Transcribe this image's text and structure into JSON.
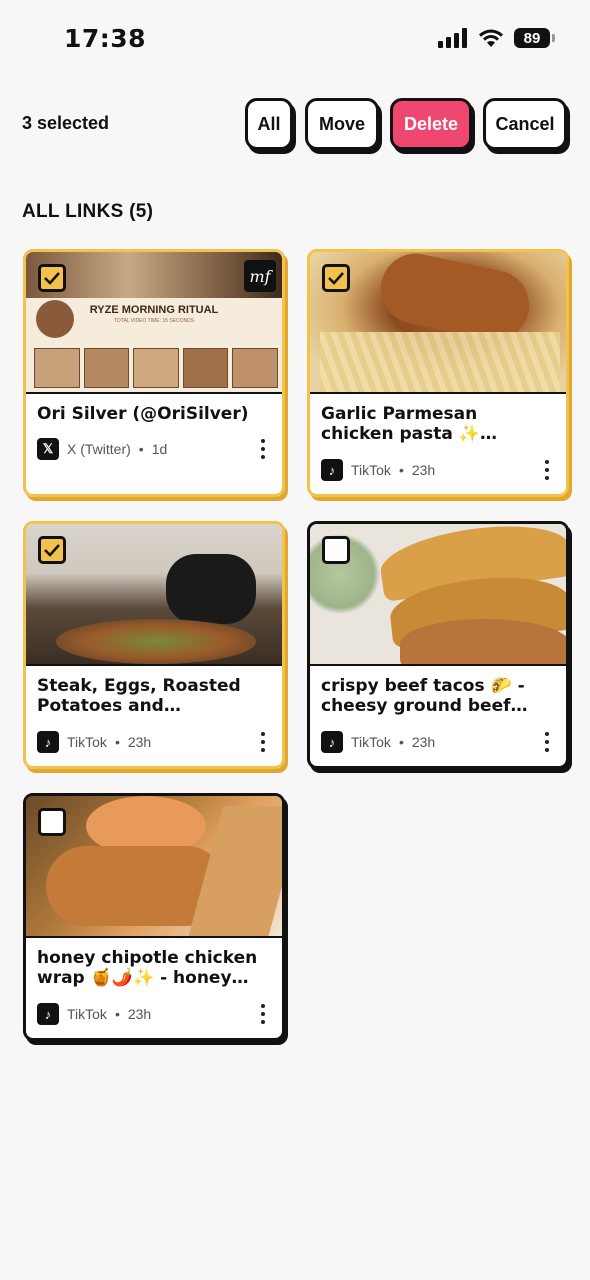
{
  "status": {
    "time": "17:38",
    "battery": "89"
  },
  "toolbar": {
    "selected_label": "3 selected",
    "all_label": "All",
    "move_label": "Move",
    "delete_label": "Delete",
    "cancel_label": "Cancel"
  },
  "section": {
    "title": "ALL LINKS (5)"
  },
  "cards": [
    {
      "title": "Ori Silver (@OriSilver)",
      "source": "X (Twitter)",
      "age": "1d",
      "selected": true,
      "thumb_text": "RYZE MORNING RITUAL",
      "thumb_subtext": "TOTAL VIDEO TIME: 15 SECONDS",
      "badge": "mf"
    },
    {
      "title": "Garlic Parmesan chicken pasta ✨ Ingredients Chi…",
      "source": "TikTok",
      "age": "23h",
      "selected": true
    },
    {
      "title": "Steak, Eggs, Roasted Potatoes and Chimichurr…",
      "source": "TikTok",
      "age": "23h",
      "selected": true
    },
    {
      "title": "crispy beef tacos 🌮 - cheesy ground beef tac…",
      "source": "TikTok",
      "age": "23h",
      "selected": false
    },
    {
      "title": "honey chipotle chicken wrap 🍯🌶️✨ - honey ch…",
      "source": "TikTok",
      "age": "23h",
      "selected": false
    }
  ],
  "colors": {
    "accent": "#f2c14e",
    "delete": "#ef476f",
    "border": "#111111"
  }
}
